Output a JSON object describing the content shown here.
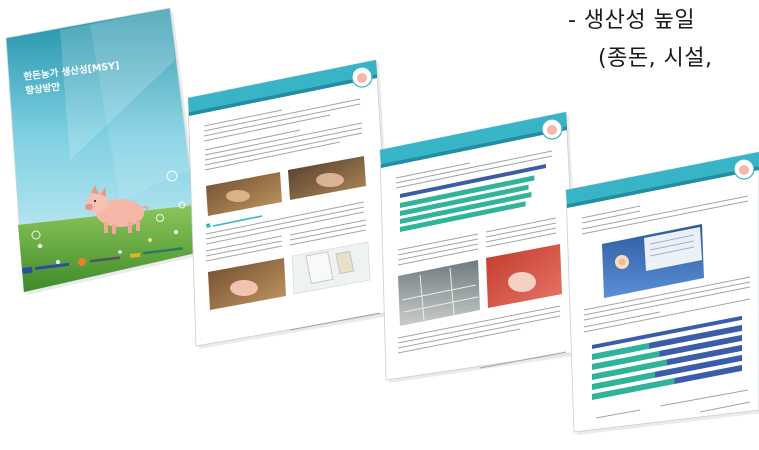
{
  "captions": {
    "line1": "- 생산성 높일",
    "line2": "(종돈, 시설,"
  },
  "booklet_cover": {
    "title_line1": "한돈농가 생산성[MSY]",
    "title_line2": "향상방안"
  },
  "colors": {
    "teal": "#37b4c6",
    "deep_teal": "#1f8fa3",
    "bar_green": "#2fb39a",
    "bar_navy": "#3b5ca8",
    "grass": "#62a83c",
    "sky": "#9fdaea"
  },
  "chart_data": [
    {
      "type": "bar",
      "orientation": "horizontal",
      "values": [
        0.92,
        0.88,
        0.9,
        0.86
      ]
    },
    {
      "type": "bar",
      "orientation": "horizontal",
      "stacked": true,
      "series": [
        {
          "values": [
            0.38,
            0.45,
            0.5,
            0.42,
            0.55
          ]
        },
        {
          "values": [
            0.62,
            0.55,
            0.5,
            0.58,
            0.45
          ]
        }
      ]
    }
  ]
}
